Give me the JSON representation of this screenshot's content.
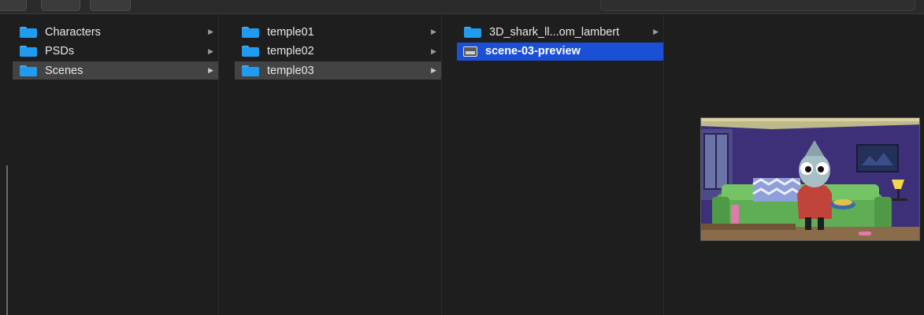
{
  "columns": [
    {
      "items": [
        {
          "label": "Characters",
          "icon": "folder-icon",
          "selected": false,
          "has_children": true
        },
        {
          "label": "PSDs",
          "icon": "folder-icon",
          "selected": false,
          "has_children": true
        },
        {
          "label": "Scenes",
          "icon": "folder-icon",
          "selected": "inactive",
          "has_children": true
        }
      ]
    },
    {
      "items": [
        {
          "label": "temple01",
          "icon": "folder-icon",
          "selected": false,
          "has_children": true
        },
        {
          "label": "temple02",
          "icon": "folder-icon",
          "selected": false,
          "has_children": true
        },
        {
          "label": "temple03",
          "icon": "folder-icon",
          "selected": "inactive",
          "has_children": true
        }
      ]
    },
    {
      "items": [
        {
          "label": "3D_shark_ll...om_lambert",
          "icon": "folder-icon",
          "selected": false,
          "has_children": true
        },
        {
          "label": "scene-03-preview",
          "icon": "image-file-icon",
          "selected": "active",
          "has_children": false
        }
      ]
    }
  ],
  "colors": {
    "background": "#1e1e1e",
    "selection_active": "#1a4fd6",
    "selection_inactive": "#434343",
    "folder": "#1f9cf0"
  },
  "preview": {
    "kind": "image",
    "subject": "cartoon shark character sitting on a green couch holding a bowl"
  }
}
